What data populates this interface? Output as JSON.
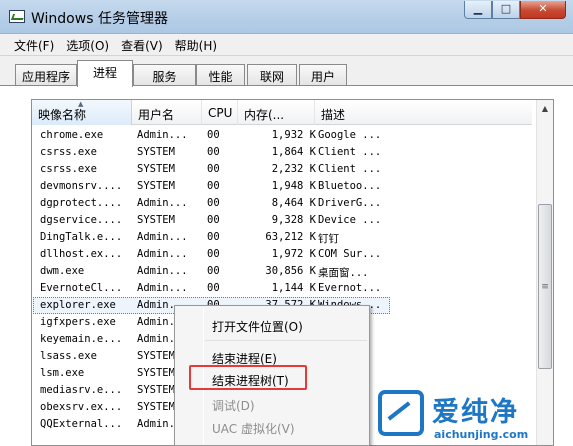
{
  "window": {
    "title": "Windows 任务管理器",
    "min_label": "▁",
    "max_label": "□",
    "close_label": "✕"
  },
  "menu": [
    "文件(F)",
    "选项(O)",
    "查看(V)",
    "帮助(H)"
  ],
  "tabs": [
    "应用程序",
    "进程",
    "服务",
    "性能",
    "联网",
    "用户"
  ],
  "active_tab": "进程",
  "columns": [
    "映像名称",
    "用户名",
    "CPU",
    "内存(...",
    "描述"
  ],
  "rows": [
    {
      "name": "chrome.exe",
      "user": "Admin...",
      "cpu": "00",
      "mem": "1,932 K",
      "desc": "Google ..."
    },
    {
      "name": "csrss.exe",
      "user": "SYSTEM",
      "cpu": "00",
      "mem": "1,864 K",
      "desc": "Client ..."
    },
    {
      "name": "csrss.exe",
      "user": "SYSTEM",
      "cpu": "00",
      "mem": "2,232 K",
      "desc": "Client ..."
    },
    {
      "name": "devmonsrv....",
      "user": "SYSTEM",
      "cpu": "00",
      "mem": "1,948 K",
      "desc": "Bluetoo..."
    },
    {
      "name": "dgprotect....",
      "user": "Admin...",
      "cpu": "00",
      "mem": "8,464 K",
      "desc": "DriverG..."
    },
    {
      "name": "dgservice....",
      "user": "SYSTEM",
      "cpu": "00",
      "mem": "9,328 K",
      "desc": "Device ..."
    },
    {
      "name": "DingTalk.e...",
      "user": "Admin...",
      "cpu": "00",
      "mem": "63,212 K",
      "desc": "钉钉"
    },
    {
      "name": "dllhost.ex...",
      "user": "Admin...",
      "cpu": "00",
      "mem": "1,972 K",
      "desc": "COM Sur..."
    },
    {
      "name": "dwm.exe",
      "user": "Admin...",
      "cpu": "00",
      "mem": "30,856 K",
      "desc": "桌面窗..."
    },
    {
      "name": "EvernoteCl...",
      "user": "Admin...",
      "cpu": "00",
      "mem": "1,144 K",
      "desc": "Evernot..."
    },
    {
      "name": "explorer.exe",
      "user": "Admin...",
      "cpu": "00",
      "mem": "37,572 K",
      "desc": "Windows..."
    },
    {
      "name": "igfxpers.exe",
      "user": "Admin...",
      "cpu": "",
      "mem": "",
      "desc": ""
    },
    {
      "name": "keyemain.e...",
      "user": "Admin...",
      "cpu": "",
      "mem": "",
      "desc": ""
    },
    {
      "name": "lsass.exe",
      "user": "SYSTEM",
      "cpu": "",
      "mem": "",
      "desc": ""
    },
    {
      "name": "lsm.exe",
      "user": "SYSTEM",
      "cpu": "",
      "mem": "",
      "desc": ""
    },
    {
      "name": "mediasrv.e...",
      "user": "SYSTEM",
      "cpu": "",
      "mem": "",
      "desc": ""
    },
    {
      "name": "obexsrv.ex...",
      "user": "SYSTEM",
      "cpu": "",
      "mem": "",
      "desc": ""
    },
    {
      "name": "QQExternal...",
      "user": "Admin...",
      "cpu": "",
      "mem": "",
      "desc": ""
    }
  ],
  "context_menu": {
    "open_location": "打开文件位置(O)",
    "end_process": "结束进程(E)",
    "end_process_tree": "结束进程树(T)",
    "debug": "调试(D)",
    "uac": "UAC 虚拟化(V)"
  },
  "watermark": {
    "title": "爱纯净",
    "url": "aichunjing.com"
  },
  "colors": {
    "highlight_box": "#e53a3a",
    "watermark": "#1e77c4"
  }
}
